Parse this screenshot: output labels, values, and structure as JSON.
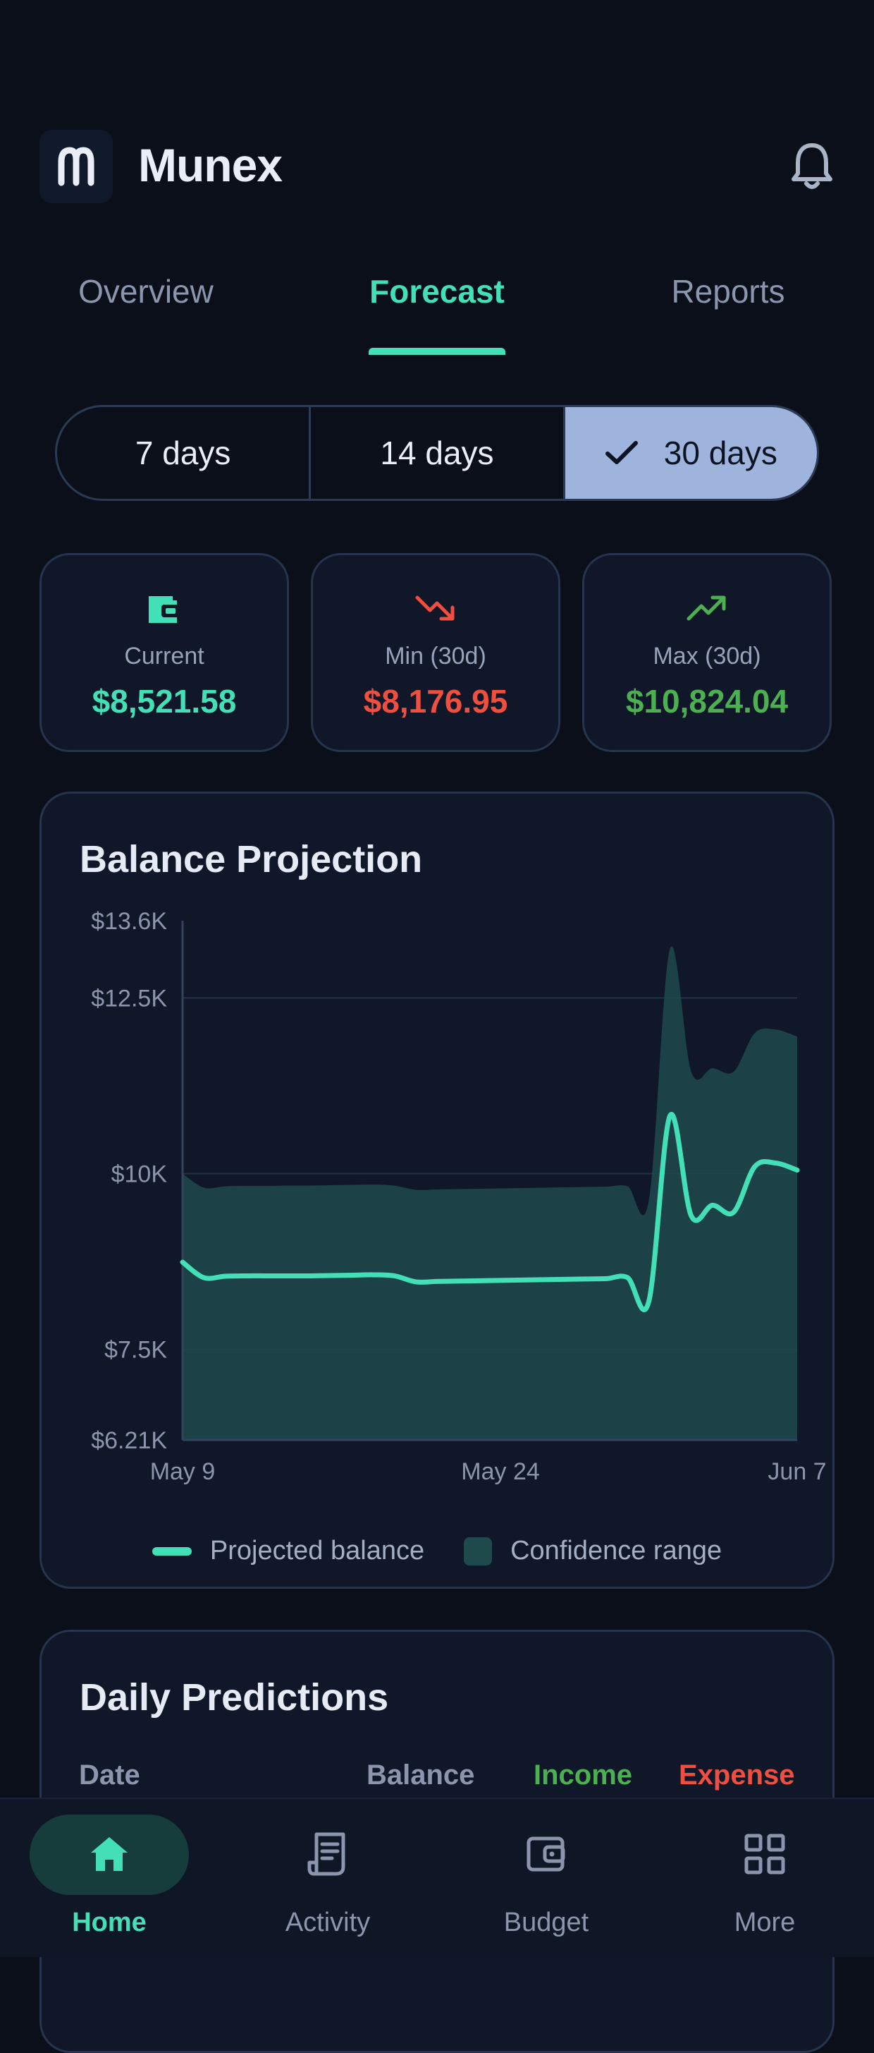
{
  "app": {
    "name": "Munex"
  },
  "tabs": [
    {
      "label": "Overview",
      "active": false
    },
    {
      "label": "Forecast",
      "active": true
    },
    {
      "label": "Reports",
      "active": false
    }
  ],
  "period": {
    "options": [
      "7 days",
      "14 days",
      "30 days"
    ],
    "selected": "30 days"
  },
  "stats": [
    {
      "icon": "wallet-icon",
      "label": "Current",
      "value": "$8,521.58",
      "color": "#43e0b8"
    },
    {
      "icon": "trending-down-icon",
      "label": "Min (30d)",
      "value": "$8,176.95",
      "color": "#ef4f3f"
    },
    {
      "icon": "trending-up-icon",
      "label": "Max (30d)",
      "value": "$10,824.04",
      "color": "#4caf50"
    }
  ],
  "chart": {
    "title": "Balance Projection",
    "legend": {
      "line": "Projected balance",
      "range": "Confidence range"
    }
  },
  "chart_data": {
    "type": "area",
    "title": "Balance Projection",
    "ylim": [
      6210,
      13600
    ],
    "y_ticks": [
      {
        "value": 13600,
        "label": "$13.6K"
      },
      {
        "value": 12500,
        "label": "$12.5K"
      },
      {
        "value": 10000,
        "label": "$10K"
      },
      {
        "value": 7500,
        "label": "$7.5K"
      },
      {
        "value": 6210,
        "label": "$6.21K"
      }
    ],
    "x_ticks": [
      {
        "day": 0,
        "label": "May 9"
      },
      {
        "day": 15,
        "label": "May 24"
      },
      {
        "day": 29,
        "label": "Jun 7"
      }
    ],
    "grid": true,
    "legend_position": "bottom",
    "x": [
      "May 9",
      "May 10",
      "May 11",
      "May 12",
      "May 13",
      "May 14",
      "May 15",
      "May 16",
      "May 17",
      "May 18",
      "May 19",
      "May 20",
      "May 21",
      "May 22",
      "May 23",
      "May 24",
      "May 25",
      "May 26",
      "May 27",
      "May 28",
      "May 29",
      "May 30",
      "May 31",
      "Jun 1",
      "Jun 2",
      "Jun 3",
      "Jun 4",
      "Jun 5",
      "Jun 6",
      "Jun 7"
    ],
    "series": [
      {
        "name": "Projected balance",
        "color": "#43e0b8",
        "values": [
          8740,
          8520,
          8540,
          8545,
          8545,
          8545,
          8545,
          8550,
          8555,
          8560,
          8545,
          8460,
          8465,
          8470,
          8475,
          8480,
          8485,
          8490,
          8495,
          8500,
          8505,
          8520,
          8180,
          10824,
          9400,
          9550,
          9450,
          10100,
          10150,
          10050
        ]
      },
      {
        "name": "Confidence range",
        "color": "#1e4a4c",
        "lower": [
          6210,
          6210,
          6210,
          6210,
          6210,
          6210,
          6210,
          6210,
          6210,
          6210,
          6210,
          6210,
          6210,
          6210,
          6210,
          6210,
          6210,
          6210,
          6210,
          6210,
          6210,
          6210,
          6210,
          6210,
          6210,
          6210,
          6210,
          6210,
          6210,
          6210
        ],
        "upper": [
          10000,
          9800,
          9820,
          9825,
          9825,
          9830,
          9830,
          9835,
          9840,
          9845,
          9830,
          9770,
          9775,
          9780,
          9785,
          9790,
          9795,
          9800,
          9805,
          9810,
          9815,
          9820,
          9620,
          13200,
          11450,
          11500,
          11450,
          12000,
          12050,
          11950
        ]
      }
    ]
  },
  "predictions": {
    "title": "Daily Predictions",
    "columns": [
      {
        "label": "Date",
        "color": "#8b96ad"
      },
      {
        "label": "Balance",
        "color": "#8b96ad"
      },
      {
        "label": "Income",
        "color": "#4caf50"
      },
      {
        "label": "Expense",
        "color": "#ef4f3f"
      }
    ]
  },
  "nav": [
    {
      "label": "Home",
      "icon": "home-icon",
      "active": true
    },
    {
      "label": "Activity",
      "icon": "receipt-icon",
      "active": false
    },
    {
      "label": "Budget",
      "icon": "wallet-icon",
      "active": false
    },
    {
      "label": "More",
      "icon": "grid-icon",
      "active": false
    }
  ]
}
